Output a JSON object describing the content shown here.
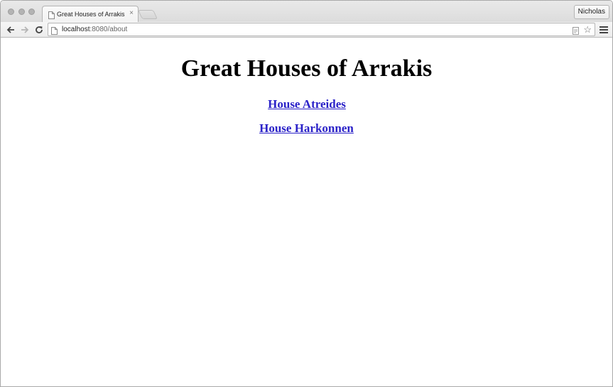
{
  "browser": {
    "tab": {
      "title": "Great Houses of Arrakis",
      "close_glyph": "×"
    },
    "profile_name": "Nicholas",
    "address_bar": {
      "host": "localhost",
      "rest": ":8080/about"
    },
    "icons": {
      "back": "back-arrow-icon",
      "forward": "forward-arrow-icon",
      "reload": "reload-icon",
      "page": "page-icon",
      "star": "star-icon",
      "menu": "hamburger-menu-icon"
    }
  },
  "page": {
    "heading": "Great Houses of Arrakis",
    "links": [
      {
        "label": "House Atreides"
      },
      {
        "label": "House Harkonnen"
      }
    ],
    "link_color": "#2b22c8"
  }
}
